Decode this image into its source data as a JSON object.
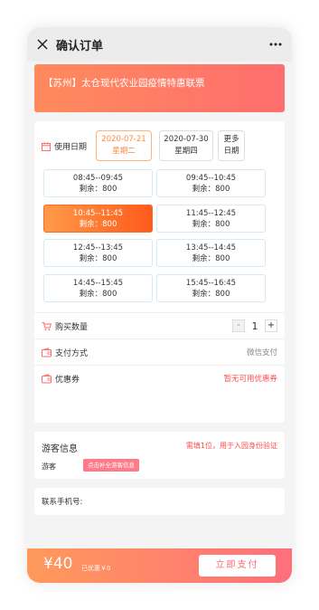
{
  "nav": {
    "title": "确认订单",
    "close_icon": "close-icon",
    "more_icon": "more-dots-icon"
  },
  "banner": {
    "text": "【苏州】太仓现代农业园疫情特惠联票"
  },
  "date": {
    "label": "使用日期",
    "options": [
      {
        "date": "2020-07-21",
        "weekday": "星期二",
        "selected": true
      },
      {
        "date": "2020-07-30",
        "weekday": "星期四",
        "selected": false
      }
    ],
    "more": {
      "l1": "更多",
      "l2": "日期"
    }
  },
  "slots": [
    {
      "time": "08:45--09:45",
      "remain": "剩余：800",
      "selected": false
    },
    {
      "time": "09:45--10:45",
      "remain": "剩余：800",
      "selected": false
    },
    {
      "time": "10:45--11:45",
      "remain": "剩余：800",
      "selected": true
    },
    {
      "time": "11:45--12:45",
      "remain": "剩余：800",
      "selected": false
    },
    {
      "time": "12:45--13:45",
      "remain": "剩余：800",
      "selected": false
    },
    {
      "time": "13:45--14:45",
      "remain": "剩余：800",
      "selected": false
    },
    {
      "time": "14:45--15:45",
      "remain": "剩余：800",
      "selected": false
    },
    {
      "time": "15:45--16:45",
      "remain": "剩余：800",
      "selected": false
    }
  ],
  "quantity": {
    "label": "购买数量",
    "minus": "-",
    "value": "1",
    "plus": "+"
  },
  "payment": {
    "label": "支付方式",
    "value": "微信支付"
  },
  "coupon": {
    "label": "优惠券",
    "value": "暂无可用优惠券"
  },
  "visitor": {
    "title": "游客信息",
    "hint": "需填1位，用于入园身份验证",
    "label": "游客",
    "button": "点击补全游客信息"
  },
  "contact": {
    "label": "联系手机号:",
    "value": ""
  },
  "footer": {
    "price": "¥40",
    "discount": "已优惠￥0",
    "pay_button": "立即支付"
  },
  "colors": {
    "accent": "#ff7a5c",
    "danger": "#ff4d4f",
    "slot_border": "#d7e9f5"
  }
}
